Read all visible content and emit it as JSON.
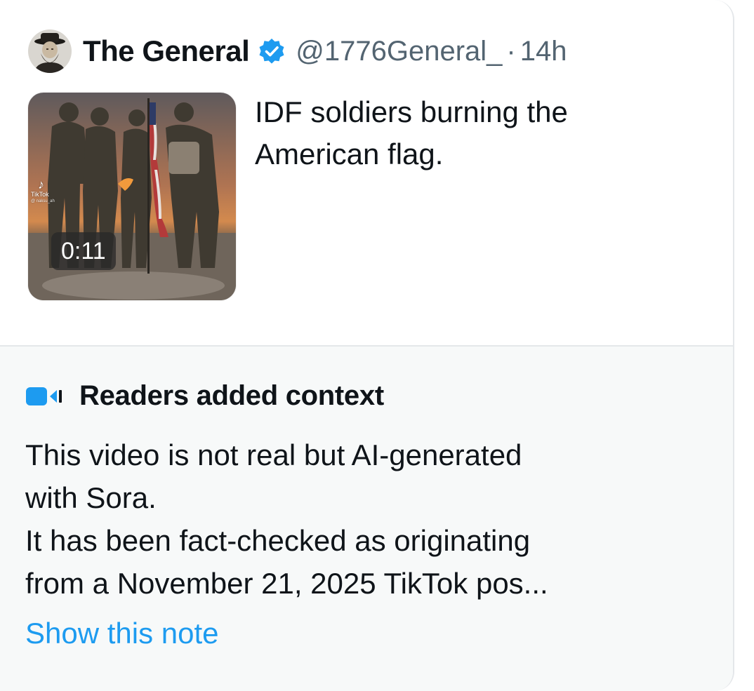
{
  "author": {
    "display_name": "The General",
    "handle": "@1776General_",
    "separator": "·",
    "timestamp": "14h",
    "verified_icon": "verified-badge-icon",
    "avatar_icon": "avatar-portrait"
  },
  "tweet": {
    "lines": [
      "IDF soldiers burning the",
      "American flag."
    ]
  },
  "media": {
    "type": "video",
    "duration": "0:11",
    "watermark": "TikTok",
    "watermark_user": "@ naksu_ah"
  },
  "community_note": {
    "icon": "community-notes-icon",
    "title": "Readers added context",
    "lines": [
      "This video is not real but AI-generated",
      "with Sora.",
      "It has been fact-checked as originating",
      "from a November 21, 2025 TikTok pos..."
    ],
    "link_label": "Show this note"
  },
  "colors": {
    "text_primary": "#0f1419",
    "text_secondary": "#536471",
    "accent_blue": "#1d9bf0",
    "verified_blue": "#1d9bf0",
    "note_background": "#f7f9f9",
    "border": "#e4e7ea"
  }
}
